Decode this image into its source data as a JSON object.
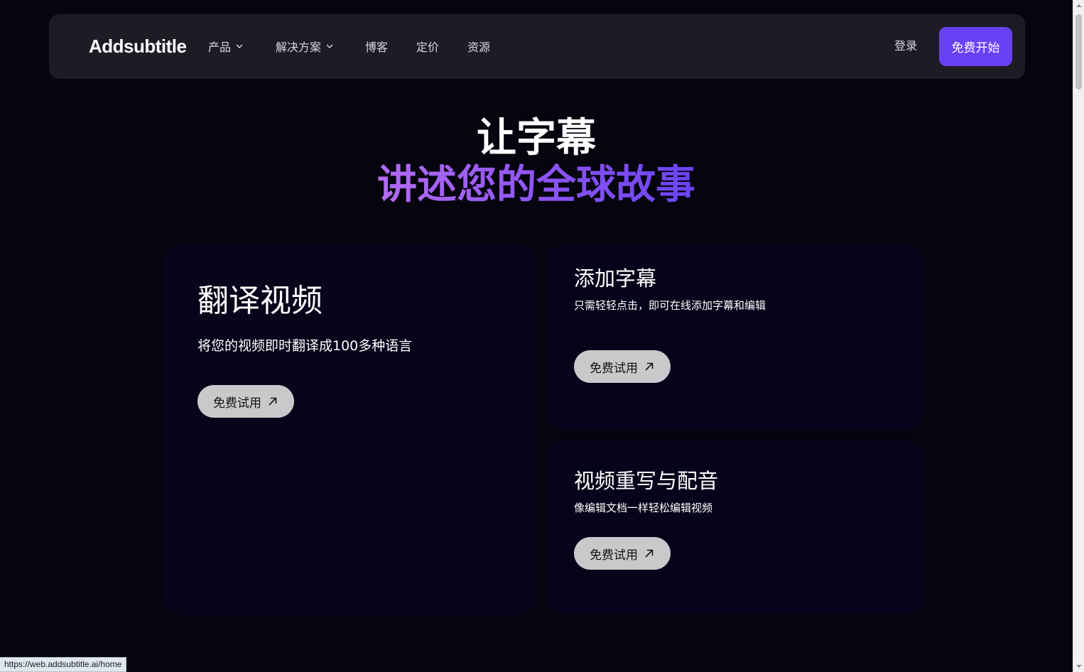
{
  "header": {
    "logo": "Addsubtitle",
    "nav": [
      {
        "label": "产品",
        "has_dropdown": true
      },
      {
        "label": "解决方案",
        "has_dropdown": true
      },
      {
        "label": "博客",
        "has_dropdown": false
      },
      {
        "label": "定价",
        "has_dropdown": false
      },
      {
        "label": "资源",
        "has_dropdown": false
      }
    ],
    "login": "登录",
    "cta": "免费开始"
  },
  "hero": {
    "line1": "让字幕",
    "line2": "讲述您的全球故事"
  },
  "features": {
    "translate": {
      "title": "翻译视频",
      "desc": "将您的视频即时翻译成100多种语言",
      "button": "免费试用"
    },
    "subtitles": {
      "title": "添加字幕",
      "desc": "只需轻轻点击，即可在线添加字幕和编辑",
      "button": "免费试用"
    },
    "rewrite": {
      "title": "视频重写与配音",
      "desc": "像编辑文档一样轻松编辑视频",
      "button": "免费试用"
    }
  },
  "status_bar": {
    "url": "https://web.addsubtitle.ai/home"
  },
  "colors": {
    "background": "#05040f",
    "navbar": "#1d1c25",
    "accent": "#6a40f7",
    "gradient_start": "#b36cf2",
    "gradient_end": "#6a43f3",
    "button_light": "#c9c9cc"
  },
  "icons": {
    "dropdown": "chevron-down-icon",
    "try_arrow": "arrow-up-right-icon"
  }
}
